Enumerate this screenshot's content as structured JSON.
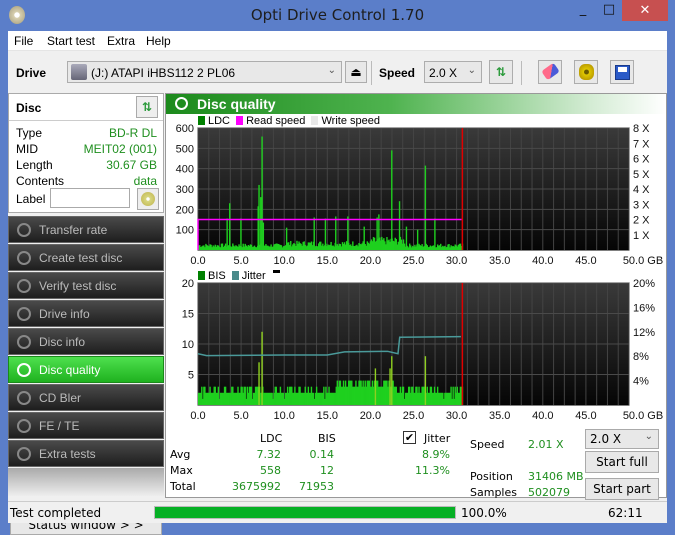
{
  "window": {
    "title": "Opti Drive Control 1.70",
    "minimize": "_",
    "maximize": "□",
    "close": "✕"
  },
  "menu": [
    "File",
    "Start test",
    "Extra",
    "Help"
  ],
  "toolbar": {
    "drive_label": "Drive",
    "drive_value": "(J:)   ATAPI iHBS112   2 PL06",
    "speed_label": "Speed",
    "speed_value": "2.0 X",
    "icons": [
      "drive-icon",
      "eject-icon",
      "refresh-icon",
      "erase-icon",
      "settings-icon",
      "save-icon"
    ]
  },
  "disc": {
    "header": "Disc",
    "props": [
      {
        "label": "Type",
        "value": "BD-R DL"
      },
      {
        "label": "MID",
        "value": "MEIT02 (001)"
      },
      {
        "label": "Length",
        "value": "30.67 GB"
      },
      {
        "label": "Contents",
        "value": "data"
      }
    ],
    "label_field": "Label",
    "label_value": ""
  },
  "nav": [
    {
      "label": "Transfer rate",
      "active": false
    },
    {
      "label": "Create test disc",
      "active": false
    },
    {
      "label": "Verify test disc",
      "active": false
    },
    {
      "label": "Drive info",
      "active": false
    },
    {
      "label": "Disc info",
      "active": false
    },
    {
      "label": "Disc quality",
      "active": true
    },
    {
      "label": "CD Bler",
      "active": false
    },
    {
      "label": "FE / TE",
      "active": false
    },
    {
      "label": "Extra tests",
      "active": false
    }
  ],
  "status_window_button": "Status window > >",
  "panel_title": "Disc quality",
  "chart_data": [
    {
      "type": "bar",
      "title": "LDC / Read speed",
      "legend": [
        {
          "name": "LDC",
          "color": "#008000"
        },
        {
          "name": "Read speed",
          "color": "#ff00ff"
        },
        {
          "name": "Write speed",
          "color": "#e8e8e8"
        }
      ],
      "x_ticks": [
        "0.0",
        "5.0",
        "10.0",
        "15.0",
        "20.0",
        "25.0",
        "30.0",
        "35.0",
        "40.0",
        "45.0",
        "50.0 GB"
      ],
      "xlim": [
        0,
        50
      ],
      "y_ticks": [
        "100",
        "200",
        "300",
        "400",
        "500",
        "600"
      ],
      "ylim": [
        0,
        600
      ],
      "y2_ticks": [
        "1 X",
        "2 X",
        "3 X",
        "4 X",
        "5 X",
        "6 X",
        "7 X",
        "8 X"
      ],
      "y2lim": [
        0,
        8
      ],
      "end_marker_gb": 30.67,
      "read_speed_x": 2.0,
      "ldc_peaks": [
        {
          "x": 3.3,
          "y": 155
        },
        {
          "x": 3.6,
          "y": 230
        },
        {
          "x": 4.9,
          "y": 155
        },
        {
          "x": 6.9,
          "y": 215
        },
        {
          "x": 7.0,
          "y": 320
        },
        {
          "x": 7.2,
          "y": 260
        },
        {
          "x": 7.35,
          "y": 558
        },
        {
          "x": 7.5,
          "y": 135
        },
        {
          "x": 10.2,
          "y": 110
        },
        {
          "x": 13.4,
          "y": 160
        },
        {
          "x": 14.7,
          "y": 155
        },
        {
          "x": 15.9,
          "y": 165
        },
        {
          "x": 17.3,
          "y": 165
        },
        {
          "x": 19.2,
          "y": 115
        },
        {
          "x": 20.7,
          "y": 160
        },
        {
          "x": 20.9,
          "y": 175
        },
        {
          "x": 22.4,
          "y": 490
        },
        {
          "x": 23.3,
          "y": 240
        },
        {
          "x": 24.1,
          "y": 115
        },
        {
          "x": 25.4,
          "y": 100
        },
        {
          "x": 26.3,
          "y": 415
        },
        {
          "x": 27.4,
          "y": 155
        }
      ],
      "ldc_baseline": 25
    },
    {
      "type": "bar",
      "title": "BIS / Jitter",
      "legend": [
        {
          "name": "BIS",
          "color": "#008000"
        },
        {
          "name": "Jitter",
          "color": "#4a8a8a"
        }
      ],
      "x_ticks": [
        "0.0",
        "5.0",
        "10.0",
        "15.0",
        "20.0",
        "25.0",
        "30.0",
        "35.0",
        "40.0",
        "45.0",
        "50.0 GB"
      ],
      "xlim": [
        0,
        50
      ],
      "y_ticks": [
        "5",
        "10",
        "15",
        "20"
      ],
      "ylim": [
        0,
        20
      ],
      "y2_ticks": [
        "4%",
        "8%",
        "12%",
        "16%",
        "20%"
      ],
      "y2lim": [
        0,
        20
      ],
      "end_marker_gb": 30.67,
      "bis_peaks": [
        {
          "x": 7.0,
          "y": 7
        },
        {
          "x": 7.35,
          "y": 12
        },
        {
          "x": 20.5,
          "y": 6
        },
        {
          "x": 22.2,
          "y": 6
        },
        {
          "x": 22.4,
          "y": 8
        },
        {
          "x": 26.3,
          "y": 8
        }
      ],
      "bis_baseline": 2,
      "jitter": [
        {
          "x": 0,
          "y": 8.4
        },
        {
          "x": 1,
          "y": 8.1
        },
        {
          "x": 10,
          "y": 8.2
        },
        {
          "x": 15,
          "y": 8.2
        },
        {
          "x": 17,
          "y": 8.7
        },
        {
          "x": 22,
          "y": 8.8
        },
        {
          "x": 23.2,
          "y": 8.4
        },
        {
          "x": 23.4,
          "y": 11.1
        },
        {
          "x": 30.5,
          "y": 11.2
        }
      ]
    }
  ],
  "stats": {
    "col_ldc": "LDC",
    "col_bis": "BIS",
    "jitter_label": "Jitter",
    "jitter_checked": true,
    "rows": [
      {
        "label": "Avg",
        "ldc": "7.32",
        "bis": "0.14",
        "jitter": "8.9%"
      },
      {
        "label": "Max",
        "ldc": "558",
        "bis": "12",
        "jitter": "11.3%"
      },
      {
        "label": "Total",
        "ldc": "3675992",
        "bis": "71953",
        "jitter": ""
      }
    ],
    "speed_label": "Speed",
    "speed_value": "2.01 X",
    "position_label": "Position",
    "position_value": "31406 MB",
    "samples_label": "Samples",
    "samples_value": "502079",
    "speed_select": "2.0 X",
    "start_full": "Start full",
    "start_part": "Start part"
  },
  "statusbar": {
    "text": "Test completed",
    "progress": 100.0,
    "progress_text": "100.0%",
    "time": "62:11"
  }
}
